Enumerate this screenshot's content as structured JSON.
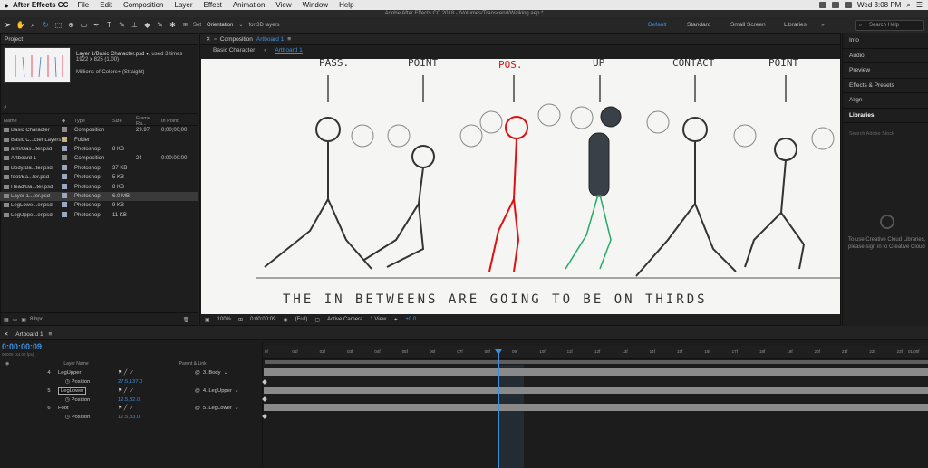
{
  "menubar": {
    "app": "After Effects CC",
    "items": [
      "File",
      "Edit",
      "Composition",
      "Layer",
      "Effect",
      "Animation",
      "View",
      "Window",
      "Help"
    ],
    "clock": "Wed 3:08 PM"
  },
  "window_title": "Adobe After Effects CC 2018 - /Volumes/Transcend/Walking.aep *",
  "toolbar": {
    "set_label": "Set",
    "orientation": "Orientation",
    "for3d": "for 3D layers"
  },
  "workspaces": [
    "Default",
    "Standard",
    "Small Screen",
    "Libraries"
  ],
  "search_help": "Search Help",
  "project": {
    "title": "Project",
    "selected": "Layer 1/Basic Character.psd ▾",
    "used": ", used 3 times",
    "dims": "1922 x 825 (1.00)",
    "colors": "Millions of Colors+ (Straight)",
    "columns": [
      "Name",
      "Type",
      "Size",
      "Frame Ra...",
      "In Point"
    ],
    "rows": [
      {
        "name": "Basic Character",
        "color": "#8a8a8a",
        "type": "Composition",
        "size": "",
        "fr": "29.97",
        "in": "0;00;00;00"
      },
      {
        "name": "Basic C...cter Layers",
        "color": "#c9b27a",
        "type": "Folder",
        "size": "",
        "fr": "",
        "in": ""
      },
      {
        "name": "arm/Bas...ter.psd",
        "color": "#9aa7c0",
        "type": "Photoshop",
        "size": "8 KB",
        "fr": "",
        "in": ""
      },
      {
        "name": "Artboard 1",
        "color": "#8a8a8a",
        "type": "Composition",
        "size": "",
        "fr": "24",
        "in": "0:00:00:00"
      },
      {
        "name": "Body/Ba...ter.psd",
        "color": "#9aa7c0",
        "type": "Photoshop",
        "size": "37 KB",
        "fr": "",
        "in": ""
      },
      {
        "name": "foot/Ba...ter.psd",
        "color": "#9aa7c0",
        "type": "Photoshop",
        "size": "5 KB",
        "fr": "",
        "in": ""
      },
      {
        "name": "Head/Ba...ter.psd",
        "color": "#9aa7c0",
        "type": "Photoshop",
        "size": "8 KB",
        "fr": "",
        "in": ""
      },
      {
        "name": "Layer 1...ter.psd",
        "color": "#9aa7c0",
        "type": "Photoshop",
        "size": "6.0 MB",
        "fr": "",
        "in": ""
      },
      {
        "name": "LegLowe...er.psd",
        "color": "#9aa7c0",
        "type": "Photoshop",
        "size": "9 KB",
        "fr": "",
        "in": ""
      },
      {
        "name": "LegUppe...er.psd",
        "color": "#9aa7c0",
        "type": "Photoshop",
        "size": "11 KB",
        "fr": "",
        "in": ""
      }
    ],
    "bpc": "8 bpc"
  },
  "comp": {
    "prefix": "Composition",
    "name": "Artboard 1",
    "crumbs": [
      "Basic Character",
      "Artboard 1"
    ],
    "labels": [
      "PASS.",
      "POINT",
      "POS.",
      "UP",
      "CONTACT",
      "POINT"
    ],
    "caption": "THE  IN BETWEENS  ARE  GOING  TO BE ON  THIRDS",
    "controls": {
      "zoom": "100%",
      "time": "0:00:00:09",
      "res": "(Full)",
      "camera": "Active Camera",
      "view": "1 View",
      "exposure": "+0.0"
    }
  },
  "right_panels": [
    "Info",
    "Audio",
    "Preview",
    "Effects & Presets",
    "Align",
    "Libraries"
  ],
  "libraries": {
    "search": "Search Adobe Stock",
    "message": "To use Creative Cloud Libraries, please sign in to Creative Cloud"
  },
  "timeline": {
    "tab": "Artboard 1",
    "timecode": "0:00:00:09",
    "sub": "00009 (24.00 fps)",
    "col_layer": "Layer Name",
    "col_parent": "Parent & Link",
    "rows": [
      {
        "num": "4",
        "name": "LegUpper",
        "parent": "3. Body"
      },
      {
        "prop": "Position",
        "value": "27.5,137.0"
      },
      {
        "num": "5",
        "name": "LegLower",
        "parent": "4. LegUpper"
      },
      {
        "prop": "Position",
        "value": "12.5,82.0"
      },
      {
        "num": "6",
        "name": "Foot",
        "parent": "5. LegLower"
      },
      {
        "prop": "Position",
        "value": "12.5,83.0"
      }
    ],
    "ruler": [
      "0f",
      "01f",
      "02f",
      "03f",
      "04f",
      "05f",
      "06f",
      "07f",
      "08f",
      "09f",
      "10f",
      "11f",
      "12f",
      "13f",
      "14f",
      "15f",
      "16f",
      "17f",
      "18f",
      "19f",
      "20f",
      "21f",
      "22f",
      "23f",
      "01:00f"
    ]
  }
}
